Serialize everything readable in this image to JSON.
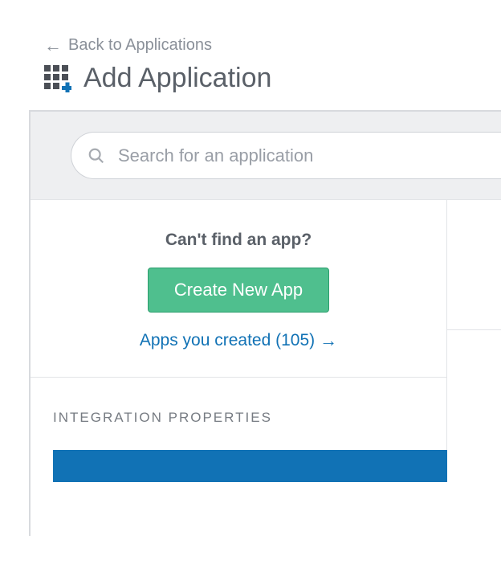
{
  "back": {
    "label": "Back to Applications"
  },
  "page": {
    "title": "Add Application"
  },
  "search": {
    "placeholder": "Search for an application"
  },
  "create": {
    "heading": "Can't find an app?",
    "button": "Create New App",
    "link": "Apps you created (105)"
  },
  "integration": {
    "heading": "INTEGRATION PROPERTIES"
  },
  "colors": {
    "accent_blue": "#1172b5",
    "button_green": "#4fbf8e"
  }
}
